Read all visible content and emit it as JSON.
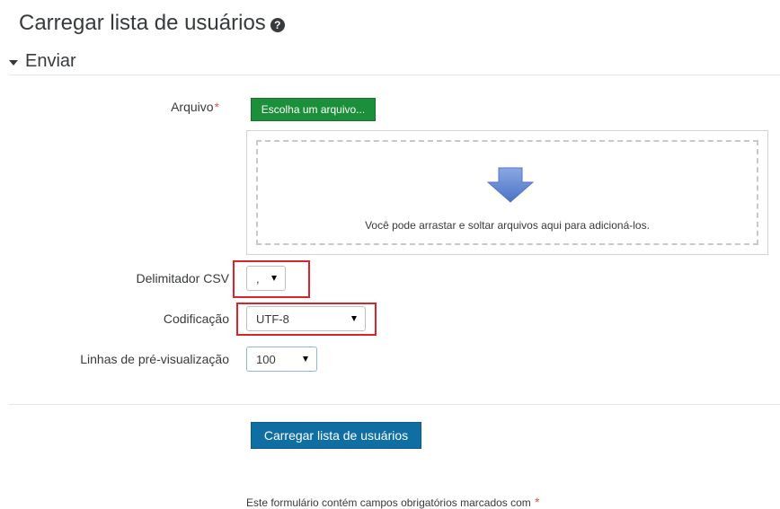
{
  "page": {
    "title": "Carregar lista de usuários",
    "help_icon": "question-circle-icon"
  },
  "section": {
    "title": "Enviar",
    "toggle_icon": "caret-down-icon"
  },
  "form": {
    "file_label": "Arquivo",
    "required_mark": "*",
    "choose_file_label": "Escolha um arquivo...",
    "dropzone_icon": "down-arrow-icon",
    "dropzone_text": "Você pode arrastar e soltar arquivos aqui para adicioná-los.",
    "delimiter_label": "Delimitador CSV",
    "delimiter_value": ",",
    "encoding_label": "Codificação",
    "encoding_value": "UTF-8",
    "preview_rows_label": "Linhas de pré-visualização",
    "preview_rows_value": "100",
    "submit_label": "Carregar lista de usuários",
    "required_note": "Este formulário contém campos obrigatórios marcados com",
    "required_note_mark": "*"
  },
  "colors": {
    "choose_button": "#1c8f3a",
    "submit_button": "#0f6fa3",
    "highlight_box": "#d9232d",
    "required": "#d9534f"
  }
}
